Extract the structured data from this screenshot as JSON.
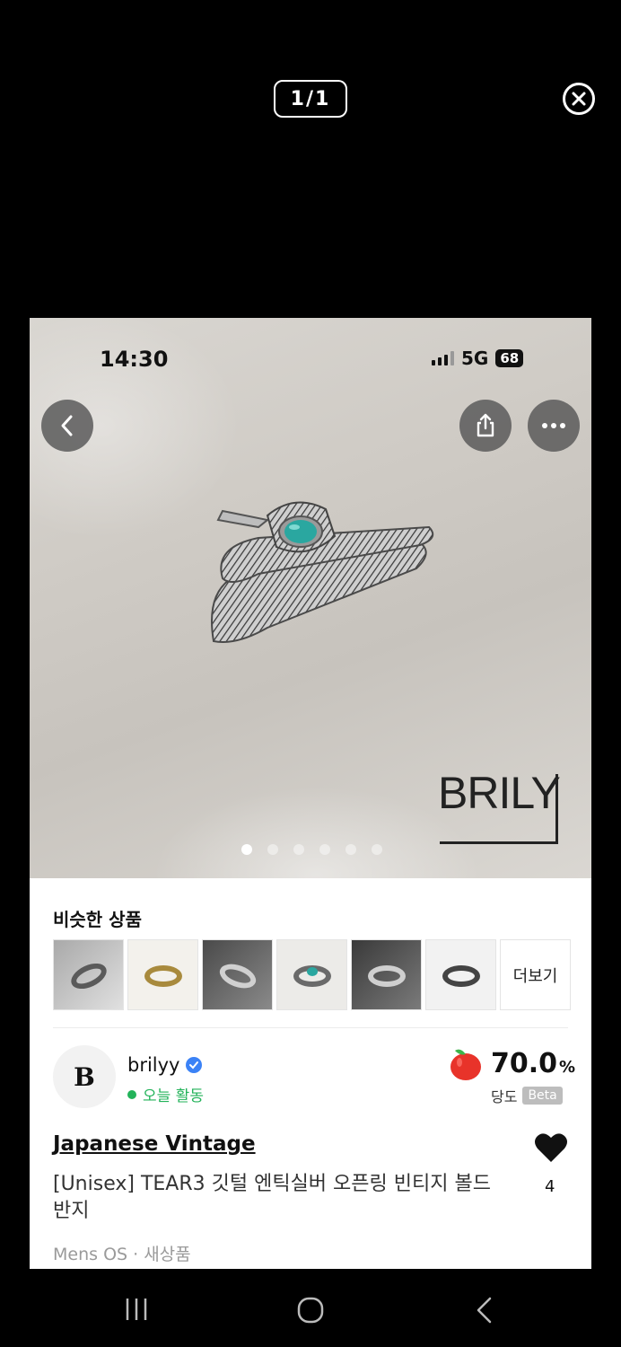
{
  "viewer": {
    "counter": "1/1",
    "close_icon": "close-icon"
  },
  "status_bar": {
    "time": "14:30",
    "network": "5G",
    "battery": "68"
  },
  "photo": {
    "watermark": "BRILY",
    "dots_total": 6,
    "dots_active": 1,
    "back_icon": "chevron-left-icon",
    "share_icon": "share-icon",
    "more_icon": "more-horizontal-icon"
  },
  "similar": {
    "title": "비슷한 상품",
    "more_label": "더보기",
    "thumb_count": 7
  },
  "seller": {
    "avatar_letter": "B",
    "name": "brilyy",
    "activity": "오늘 활동"
  },
  "sweetness": {
    "value": "70.0",
    "unit": "%",
    "label": "당도",
    "badge": "Beta"
  },
  "product": {
    "shop_name": "Japanese Vintage",
    "title": "[Unisex] TEAR3 깃털 엔틱실버 오픈링 빈티지 볼드 반지",
    "meta": "Mens OS · 새상품",
    "likes": "4"
  },
  "colors": {
    "active_green": "#23b35a",
    "verified_blue": "#3b82f6"
  }
}
